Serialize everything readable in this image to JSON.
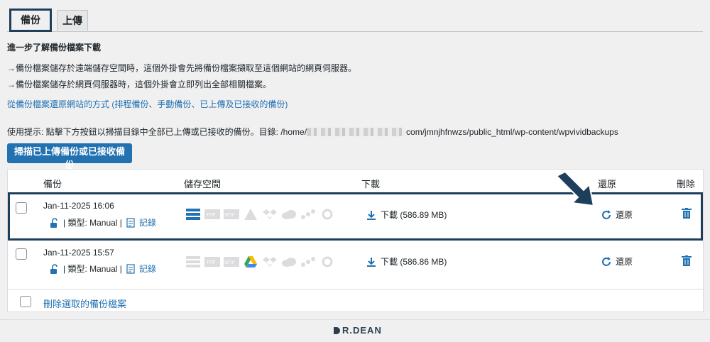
{
  "tabs": [
    {
      "label": "備份",
      "active": true
    },
    {
      "label": "上傳",
      "active": false
    }
  ],
  "info": {
    "heading": "進一步了解備份檔案下載",
    "line1": "→備份檔案儲存於遠端儲存空間時，這個外掛會先將備份檔案擷取至這個網站的網頁伺服器。",
    "line2": "→備份檔案儲存於網頁伺服器時，這個外掛會立即列出全部相關檔案。",
    "restore_link": "從備份檔案還原網站的方式 (排程備份、手動備份、已上傳及已接收的備份)",
    "hint_prefix": "使用提示: 點擊下方按鈕以掃描目錄中全部已上傳或已接收的備份。目錄: /home/",
    "hint_suffix": "com/jmnjhfnwzs/public_html/wp-content/wpvividbackups"
  },
  "scan_button": "掃描已上傳備份或已接收備份",
  "table": {
    "headers": {
      "backup": "備份",
      "storage": "儲存空間",
      "download": "下載",
      "restore": "還原",
      "delete": "刪除"
    },
    "rows": [
      {
        "date": "Jan-11-2025 16:06",
        "type_text": "| 類型: Manual |",
        "log": "記錄",
        "download": "下載 (586.89 MB)",
        "restore": "還原",
        "storage_active": [
          "local"
        ]
      },
      {
        "date": "Jan-11-2025 15:57",
        "type_text": "| 類型: Manual |",
        "log": "記錄",
        "download": "下載 (586.86 MB)",
        "restore": "還原",
        "storage_active": [
          "google-drive"
        ]
      }
    ],
    "delete_selected": "刪除選取的備份檔案"
  },
  "brand": "R.DEAN",
  "colors": {
    "accent": "#2271b1",
    "highlight": "#1d3f5c",
    "background": "#f0f0f1"
  }
}
